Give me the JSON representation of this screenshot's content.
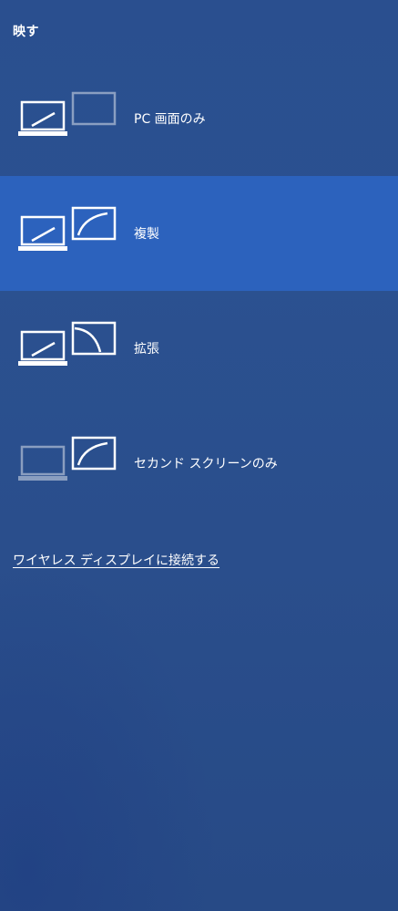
{
  "panel": {
    "title": "映す"
  },
  "options": [
    {
      "label": "PC 画面のみ",
      "icon": "pc-screen-only-icon",
      "selected": false
    },
    {
      "label": "複製",
      "icon": "duplicate-icon",
      "selected": true
    },
    {
      "label": "拡張",
      "icon": "extend-icon",
      "selected": false
    },
    {
      "label": "セカンド スクリーンのみ",
      "icon": "second-screen-only-icon",
      "selected": false
    }
  ],
  "link": {
    "wireless_display": "ワイヤレス ディスプレイに接続する"
  },
  "colors": {
    "background": "#2b5190",
    "selected": "#2c62bd",
    "text": "#ffffff"
  }
}
